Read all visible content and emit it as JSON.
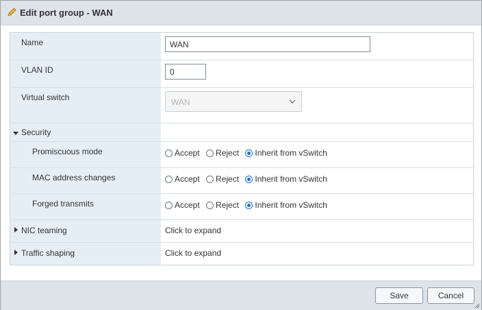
{
  "dialog": {
    "title": "Edit port group - WAN",
    "icon": "pencil-icon"
  },
  "fields": {
    "name_label": "Name",
    "name_value": "WAN",
    "vlan_label": "VLAN ID",
    "vlan_value": "0",
    "vswitch_label": "Virtual switch",
    "vswitch_value": "WAN"
  },
  "security": {
    "label": "Security",
    "options": [
      "Accept",
      "Reject",
      "Inherit from vSwitch"
    ],
    "rows": [
      {
        "label": "Promiscuous mode",
        "selected": "Inherit from vSwitch"
      },
      {
        "label": "MAC address changes",
        "selected": "Inherit from vSwitch"
      },
      {
        "label": "Forged transmits",
        "selected": "Inherit from vSwitch"
      }
    ]
  },
  "nic_teaming": {
    "label": "NIC teaming",
    "value": "Click to expand"
  },
  "traffic_shaping": {
    "label": "Traffic shaping",
    "value": "Click to expand"
  },
  "footer": {
    "save_label": "Save",
    "cancel_label": "Cancel"
  },
  "colors": {
    "accent": "#1a6fd4",
    "label_bg": "#e5eef5",
    "bar_bg": "#dde3e9"
  }
}
